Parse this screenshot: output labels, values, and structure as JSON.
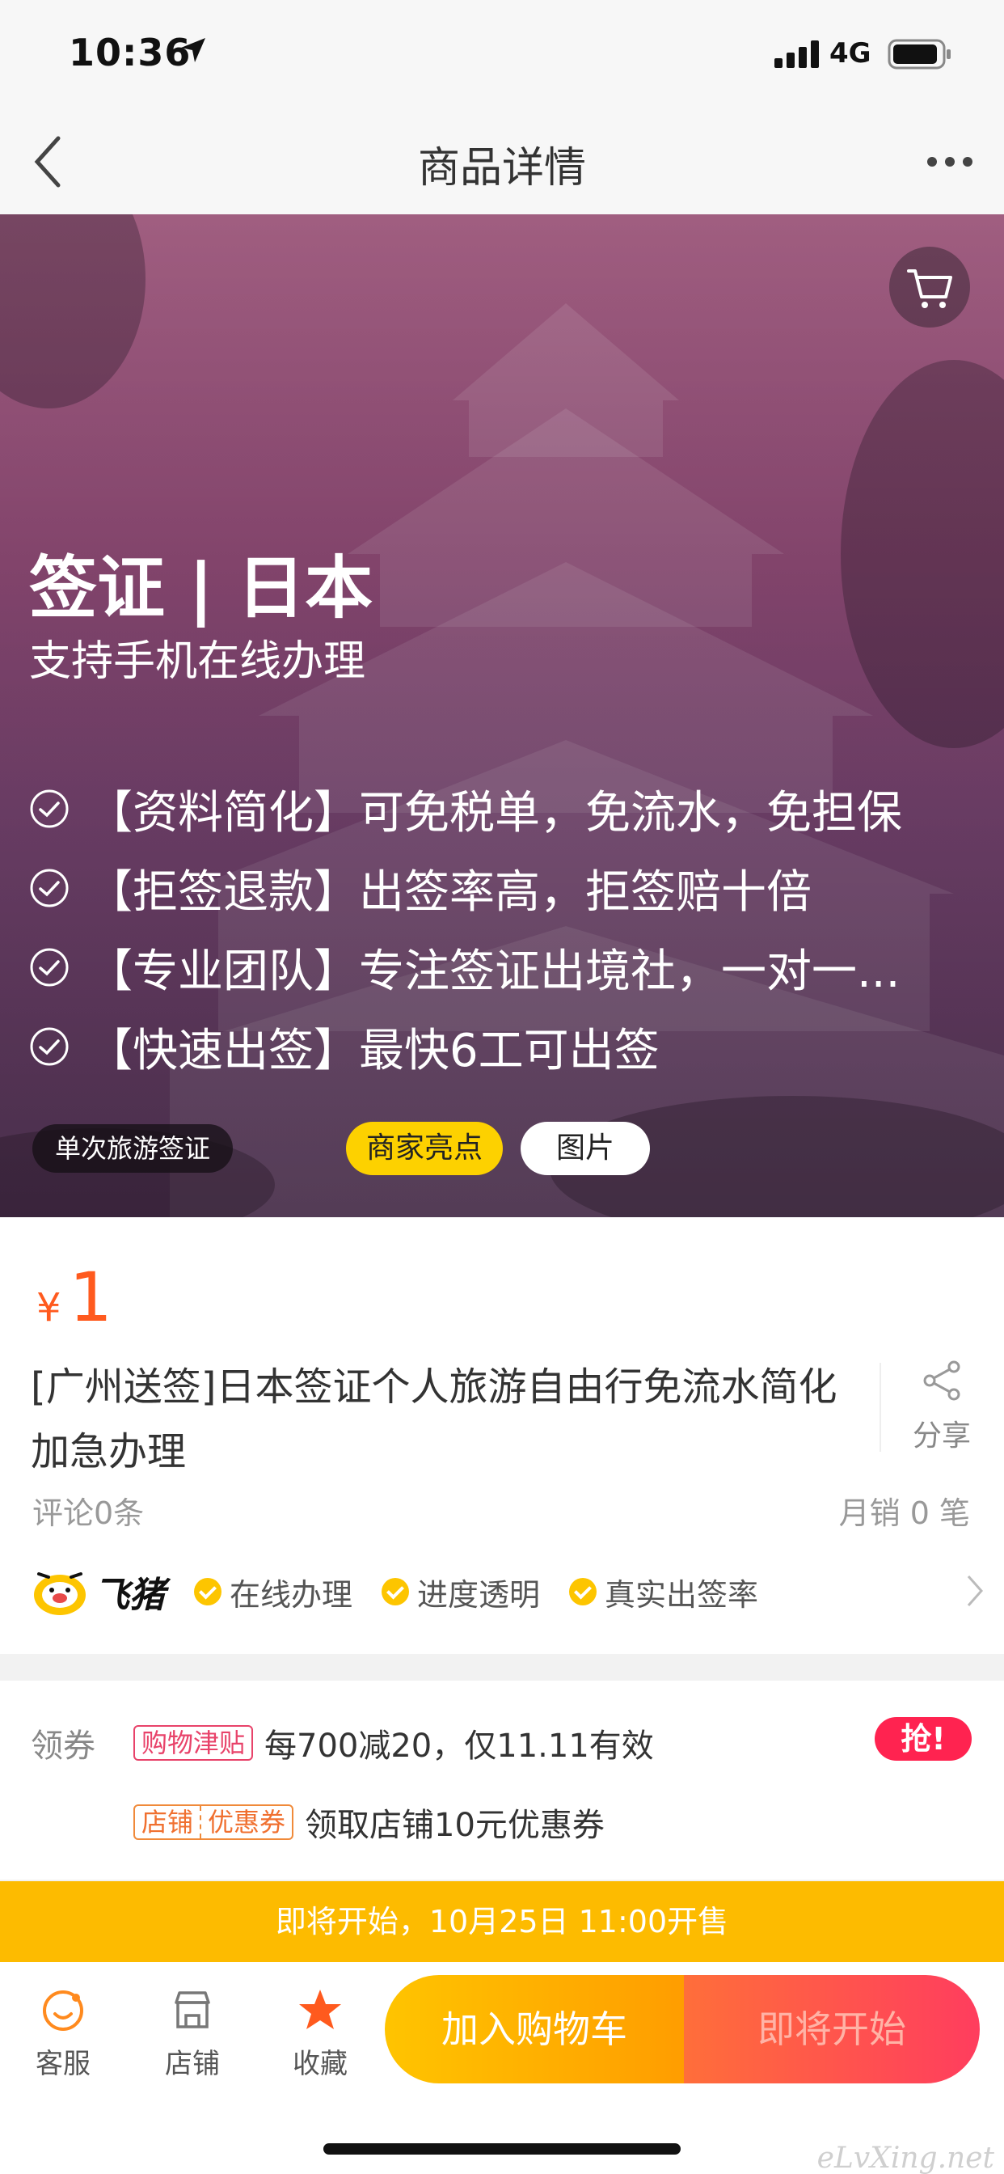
{
  "status_bar": {
    "time": "10:36",
    "network": "4G"
  },
  "nav": {
    "title": "商品详情"
  },
  "hero": {
    "title": "签证 | 日本",
    "subtitle": "支持手机在线办理",
    "features": [
      {
        "tag": "【资料简化】",
        "text": "可免税单，免流水，免担保"
      },
      {
        "tag": "【拒签退款】",
        "text": "出签率高，拒签赔十倍"
      },
      {
        "tag": "【专业团队】",
        "text": "专注签证出境社，一对一..."
      },
      {
        "tag": "【快速出签】",
        "text": "最快6工可出签"
      }
    ],
    "visa_type_tag": "单次旅游签证",
    "highlight_tab": "商家亮点",
    "image_tab": "图片"
  },
  "product": {
    "currency": "¥",
    "price": "1",
    "title": "[广州送签]日本签证个人旅游自由行免流水简化加急办理",
    "share_label": "分享",
    "reviews": "评论0条",
    "monthly_sales": "月销 0 笔",
    "brand_name": "飞猪",
    "assurances": [
      "在线办理",
      "进度透明",
      "真实出签率"
    ]
  },
  "coupons": {
    "label": "领券",
    "items": [
      {
        "badge": "购物津贴",
        "text": "每700减20，仅11.11有效"
      },
      {
        "badge_left": "店铺",
        "badge_right": "优惠券",
        "text": "领取店铺10元优惠券"
      }
    ],
    "grab_label": "抢!"
  },
  "presale_banner": "即将开始，10月25日 11:00开售",
  "bottom_bar": {
    "service": "客服",
    "shop": "店铺",
    "favorite": "收藏",
    "add_to_cart": "加入购物车",
    "coming_soon": "即将开始"
  },
  "watermark": "eLvXing.net",
  "colors": {
    "price": "#ff5a1e",
    "accent_yellow": "#fdd100",
    "grab_red": "#ff2350",
    "presale": "#fdbb00"
  }
}
